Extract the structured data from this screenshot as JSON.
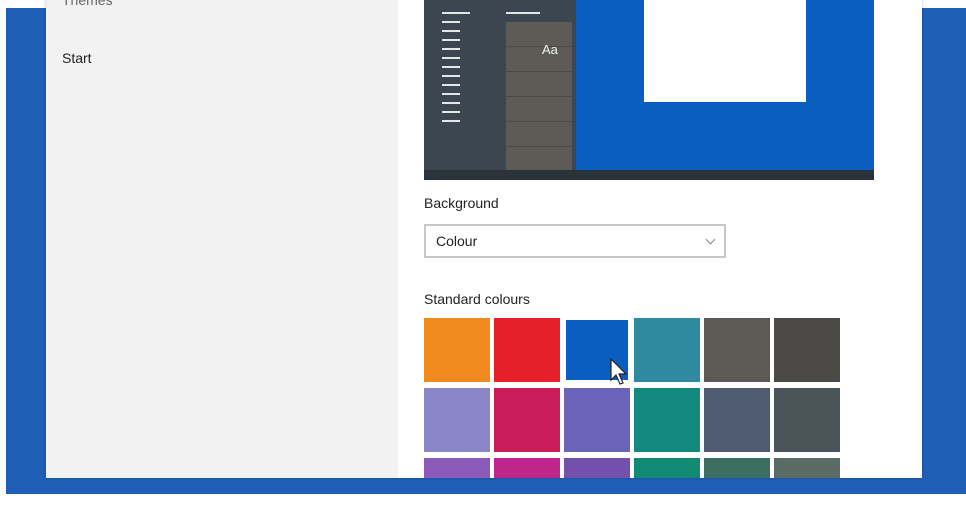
{
  "nav": {
    "items": [
      {
        "label": "Themes",
        "state": "partially-visible"
      },
      {
        "label": "Start"
      }
    ]
  },
  "preview": {
    "tile_text": "Aa",
    "accent_color": "#0a5ec2"
  },
  "background": {
    "label": "Background",
    "dropdown_value": "Colour"
  },
  "standard_colours": {
    "label": "Standard colours",
    "selected_index": 2,
    "swatches": [
      "#f08a1c",
      "#e5202a",
      "#0a5ec2",
      "#2f8aa0",
      "#5d5a56",
      "#4c4a47",
      "#8b86c8",
      "#c91d5a",
      "#6a63b9",
      "#138a7e",
      "#4f5b70",
      "#4b5559",
      "#8a5bb8",
      "#c0258b",
      "#7450ad",
      "#118a74",
      "#3d6e62",
      "#596b63"
    ]
  }
}
